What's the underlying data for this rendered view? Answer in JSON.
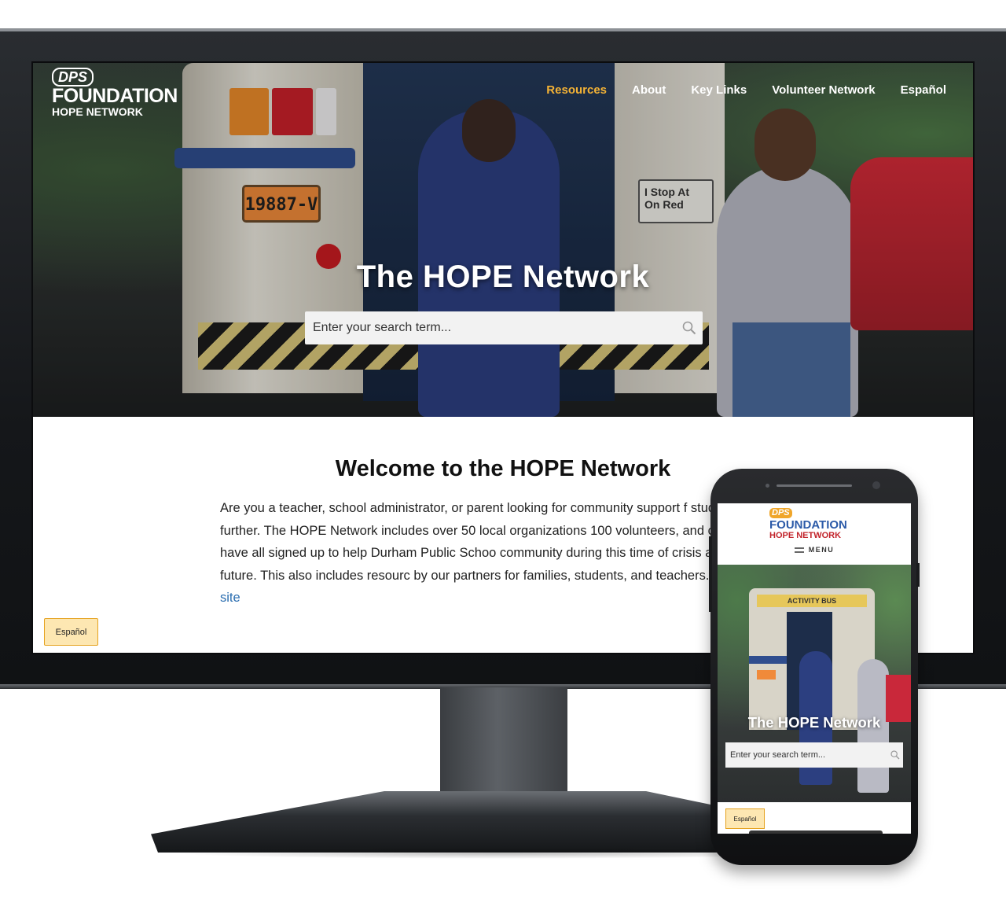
{
  "desktop": {
    "logo": {
      "dps": "DPS",
      "foundation": "FOUNDATION",
      "sub": "HOPE NETWORK"
    },
    "nav": [
      {
        "label": "Resources",
        "active": true
      },
      {
        "label": "About",
        "active": false
      },
      {
        "label": "Key Links",
        "active": false
      },
      {
        "label": "Volunteer Network",
        "active": false
      },
      {
        "label": "Español",
        "active": false
      }
    ],
    "hero": {
      "title": "The HOPE Network",
      "search_placeholder": "Enter your search term...",
      "plate_text": "19887-V",
      "sign_text": "I Stop At On Red"
    },
    "welcome": {
      "title": "Welcome to the HOPE Network",
      "body": "Are you a teacher, school administrator, or parent looking for community support f students? Look no further. The HOPE Network includes over 50 local organizations 100 volunteers, and counting, who have all signed up to help Durham Public Schoo community during this time of crisis and into the future. This also includes resourc by our partners for families, students, and teachers.",
      "link": "How to use this site"
    },
    "espanol_button": "Español"
  },
  "mobile": {
    "logo": {
      "dps": "DPS",
      "foundation": "FOUNDATION",
      "sub": "HOPE NETWORK"
    },
    "menu_label": "MENU",
    "bus_label": "ACTIVITY BUS",
    "hero_title": "The HOPE Network",
    "search_placeholder": "Enter your search term...",
    "espanol_button": "Español"
  },
  "colors": {
    "nav_active": "#f5b335",
    "link": "#2a6db0",
    "espanol_bg": "#fde7b2",
    "espanol_border": "#e5a21f",
    "logo_blue": "#2b5aa8",
    "logo_red": "#c2242b",
    "logo_orange": "#f0a62a"
  }
}
